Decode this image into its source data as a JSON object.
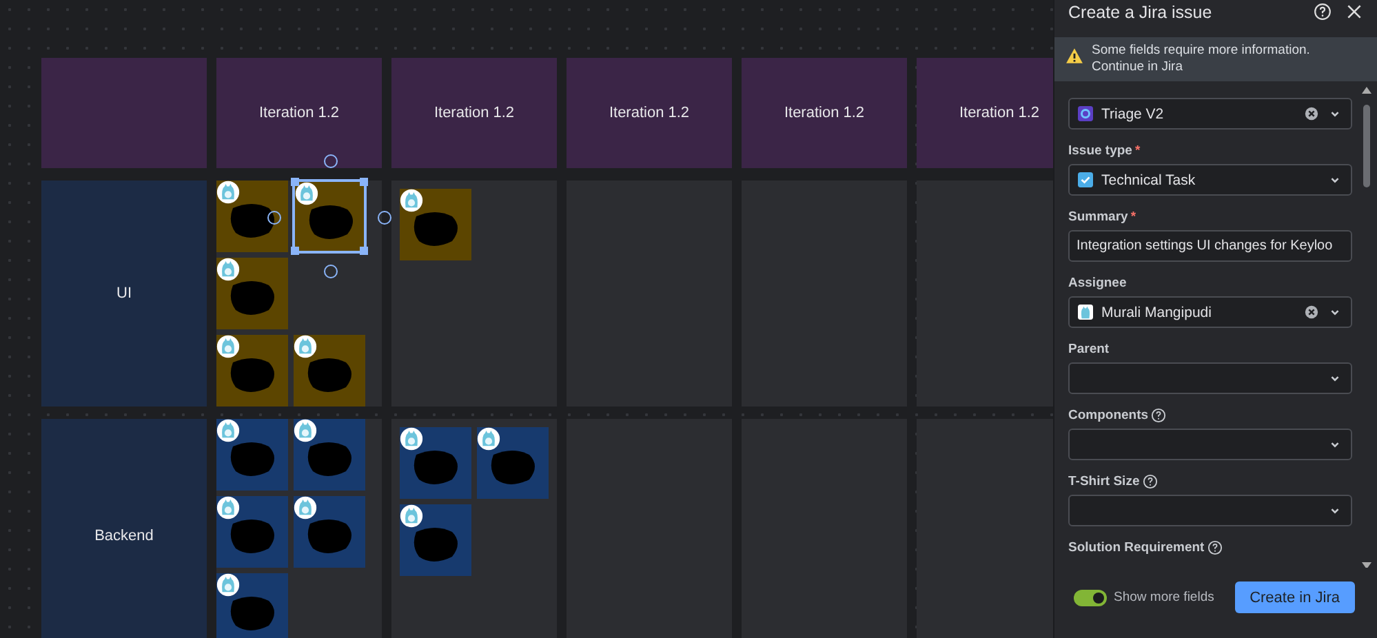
{
  "board": {
    "columns": [
      "Iteration 1.2",
      "Iteration 1.2",
      "Iteration 1.2",
      "Iteration 1.2",
      "Iteration 1.2"
    ],
    "rows": [
      {
        "label": "UI",
        "color": "#1c2b45",
        "cells": [
          {
            "notes": [
              {
                "color": "#5c4500",
                "selected": false
              },
              {
                "color": "#5c4500",
                "selected": true
              },
              {
                "color": "#5c4500",
                "selected": false
              },
              {
                "color": "#5c4500",
                "selected": false
              },
              {
                "color": "#5c4500",
                "selected": false
              }
            ]
          },
          {
            "notes": [
              {
                "color": "#5c4500",
                "selected": false
              }
            ]
          },
          {},
          {},
          {}
        ]
      },
      {
        "label": "Backend",
        "color": "#1c2b45",
        "cells": [
          {
            "notes": [
              {
                "color": "#173a6e",
                "selected": false
              },
              {
                "color": "#173a6e",
                "selected": false
              },
              {
                "color": "#173a6e",
                "selected": false
              },
              {
                "color": "#173a6e",
                "selected": false
              },
              {
                "color": "#173a6e",
                "selected": false
              }
            ]
          },
          {
            "notes": [
              {
                "color": "#173a6e",
                "selected": false
              },
              {
                "color": "#173a6e",
                "selected": false
              },
              {
                "color": "#173a6e",
                "selected": false
              }
            ]
          },
          {},
          {},
          {}
        ]
      }
    ]
  },
  "panel": {
    "title": "Create a Jira issue",
    "warning": "Some fields require more information. Continue in Jira",
    "fields": [
      {
        "kind": "project",
        "value": "Triage V2",
        "clearable": true
      },
      {
        "kind": "issuetype",
        "label": "Issue type",
        "required_mark": "*",
        "value": "Technical Task"
      },
      {
        "kind": "text",
        "label": "Summary",
        "required_mark": "*",
        "value": "Integration settings UI changes for Keyloo"
      },
      {
        "kind": "user",
        "label": "Assignee",
        "value": "Murali Mangipudi",
        "clearable": true
      },
      {
        "kind": "select",
        "label": "Parent"
      },
      {
        "kind": "select",
        "label": "Components",
        "help": true
      },
      {
        "kind": "select",
        "label": "T-Shirt Size",
        "help": true
      },
      {
        "kind": "label",
        "label": "Solution Requirement",
        "help": true
      }
    ],
    "show_more": {
      "label": "Show more fields",
      "on": true
    },
    "submit": "Create in Jira"
  }
}
